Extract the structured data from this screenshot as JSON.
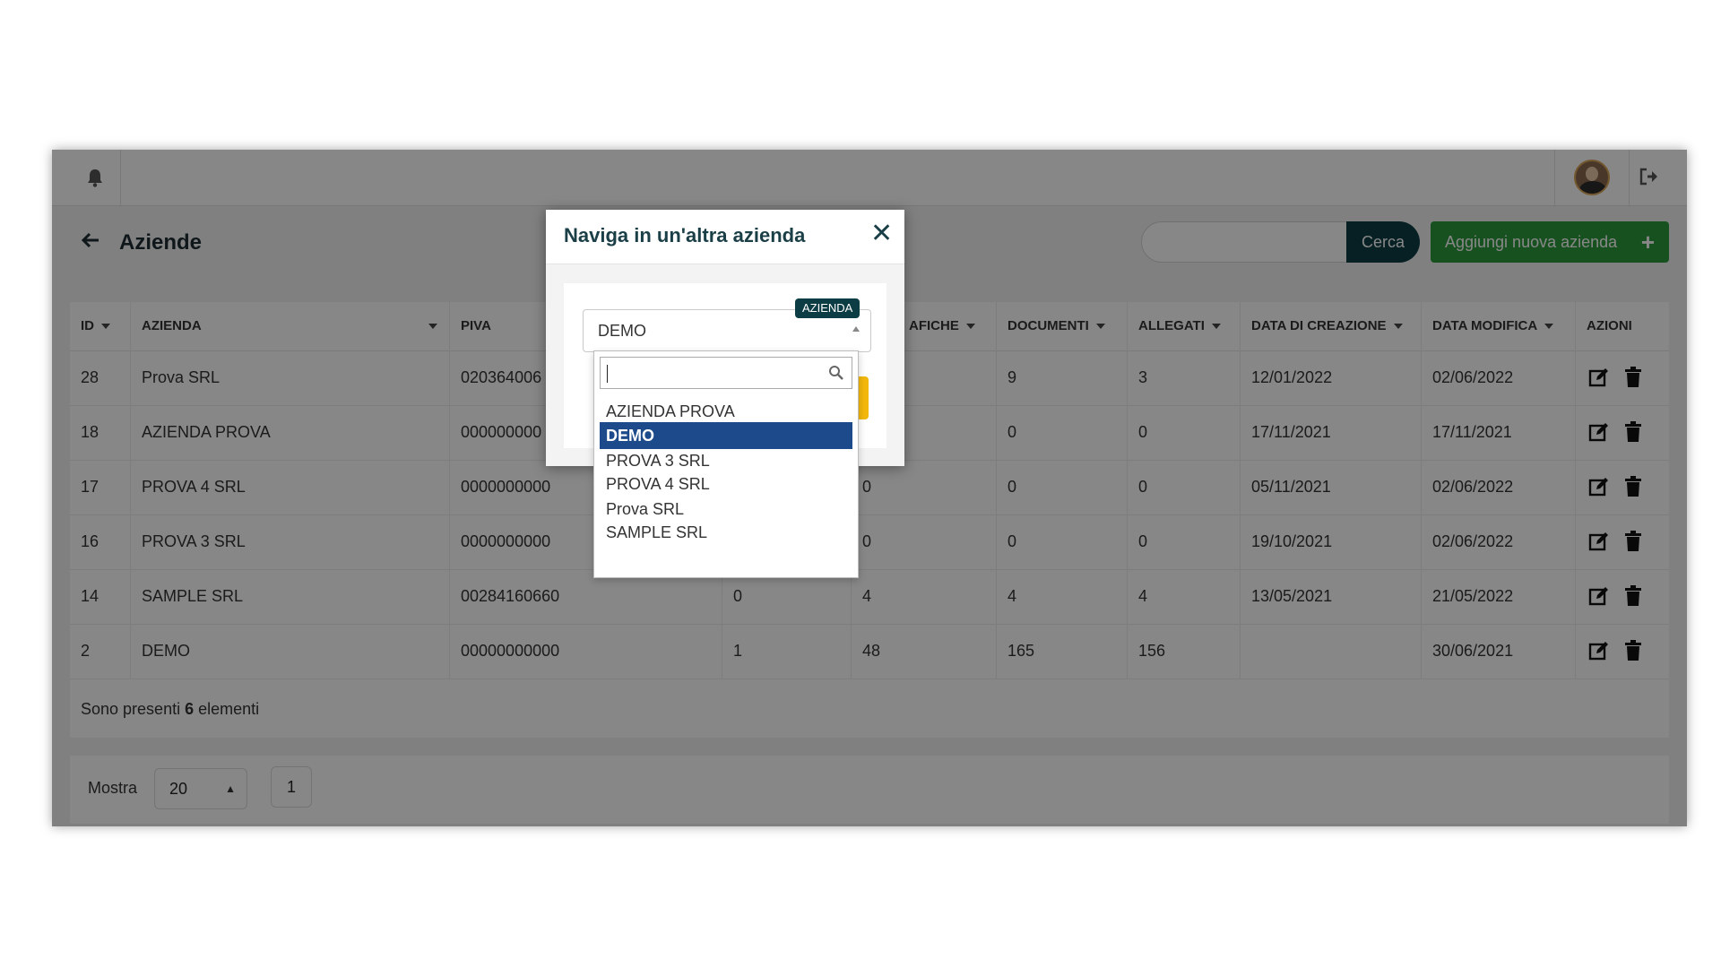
{
  "page": {
    "title": "Aziende"
  },
  "search": {
    "button_label": "Cerca",
    "placeholder": ""
  },
  "add_button": {
    "label": "Aggiungi nuova azienda",
    "icon": "+"
  },
  "table": {
    "columns": [
      "ID",
      "AZIENDA",
      "PIVA",
      "",
      "AFICHE",
      "DOCUMENTI",
      "ALLEGATI",
      "DATA DI CREAZIONE",
      "DATA MODIFICA",
      "AZIONI"
    ],
    "rows": [
      [
        "28",
        "Prova SRL",
        "020364006",
        "",
        "",
        "9",
        "3",
        "12/01/2022",
        "02/06/2022"
      ],
      [
        "18",
        "AZIENDA PROVA",
        "000000000",
        "",
        "",
        "0",
        "0",
        "17/11/2021",
        "17/11/2021"
      ],
      [
        "17",
        "PROVA 4 SRL",
        "0000000000",
        "",
        "0",
        "0",
        "0",
        "05/11/2021",
        "02/06/2022"
      ],
      [
        "16",
        "PROVA 3 SRL",
        "0000000000",
        "",
        "0",
        "0",
        "0",
        "19/10/2021",
        "02/06/2022"
      ],
      [
        "14",
        "SAMPLE SRL",
        "00284160660",
        "0",
        "4",
        "4",
        "4",
        "13/05/2021",
        "21/05/2022"
      ],
      [
        "2",
        "DEMO",
        "00000000000",
        "1",
        "48",
        "165",
        "156",
        "",
        "30/06/2021"
      ]
    ]
  },
  "footer": {
    "prefix": "Sono presenti ",
    "count": "6",
    "suffix": " elementi"
  },
  "pagination": {
    "show_label": "Mostra",
    "page_size": "20",
    "current_page": "1"
  },
  "modal": {
    "title": "Naviga in un'altra azienda",
    "close_icon": "✕",
    "select_badge": "AZIENDA",
    "selected_value": "DEMO",
    "search_value": "",
    "options": [
      "AZIENDA PROVA",
      "DEMO",
      "PROVA 3 SRL",
      "PROVA 4 SRL",
      "Prova SRL",
      "SAMPLE SRL"
    ],
    "highlighted_option": "DEMO"
  },
  "colors": {
    "primary": "#0c3d44",
    "success": "#2e9a3d",
    "highlight": "#1c4a8a",
    "warning": "#f2b70b"
  }
}
